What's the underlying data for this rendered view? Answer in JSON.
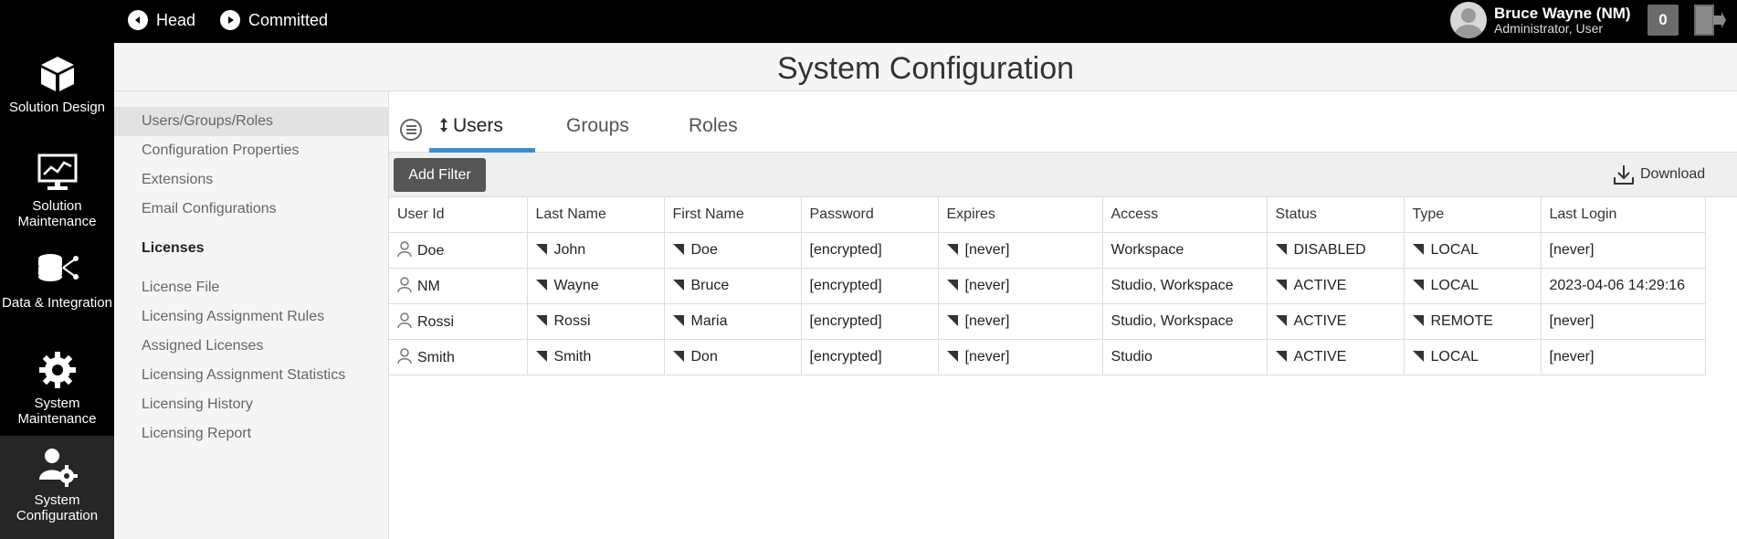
{
  "topbar": {
    "branch": "Head",
    "state": "Committed",
    "user_name": "Bruce Wayne (NM)",
    "user_role": "Administrator, User",
    "notification_count": "0"
  },
  "leftnav": {
    "items": [
      {
        "label": "Solution Design",
        "icon": "cube-icon"
      },
      {
        "label": "Solution Maintenance",
        "icon": "monitor-chart-icon"
      },
      {
        "label": "Data & Integration",
        "icon": "database-network-icon"
      },
      {
        "label": "System Maintenance",
        "icon": "gear-icon"
      },
      {
        "label": "System Configuration",
        "icon": "user-gear-icon",
        "active": true
      }
    ]
  },
  "page_title": "System Configuration",
  "subnav": {
    "items_top": [
      "Users/Groups/Roles",
      "Configuration Properties",
      "Extensions",
      "Email Configurations"
    ],
    "licenses_heading": "Licenses",
    "items_licenses": [
      "License File",
      "Licensing Assignment Rules",
      "Assigned Licenses",
      "Licensing Assignment Statistics",
      "Licensing History",
      "Licensing Report"
    ]
  },
  "tabs": [
    "Users",
    "Groups",
    "Roles"
  ],
  "toolbar": {
    "add_filter": "Add Filter",
    "download": "Download"
  },
  "table": {
    "columns": [
      "User Id",
      "Last Name",
      "First Name",
      "Password",
      "Expires",
      "Access",
      "Status",
      "Type",
      "Last Login"
    ],
    "rows": [
      [
        "Doe",
        "John",
        "Doe",
        "[encrypted]",
        "[never]",
        "Workspace",
        "DISABLED",
        "LOCAL",
        "[never]"
      ],
      [
        "NM",
        "Wayne",
        "Bruce",
        "[encrypted]",
        "[never]",
        "Studio, Workspace",
        "ACTIVE",
        "LOCAL",
        "2023-04-06 14:29:16"
      ],
      [
        "Rossi",
        "Rossi",
        "Maria",
        "[encrypted]",
        "[never]",
        "Studio, Workspace",
        "ACTIVE",
        "REMOTE",
        "[never]"
      ],
      [
        "Smith",
        "Smith",
        "Don",
        "[encrypted]",
        "[never]",
        "Studio",
        "ACTIVE",
        "LOCAL",
        "[never]"
      ]
    ]
  },
  "colors": {
    "topbar_bg": "#000000",
    "active_tab_underline": "#3b8fd6",
    "add_filter_bg": "#555555"
  }
}
